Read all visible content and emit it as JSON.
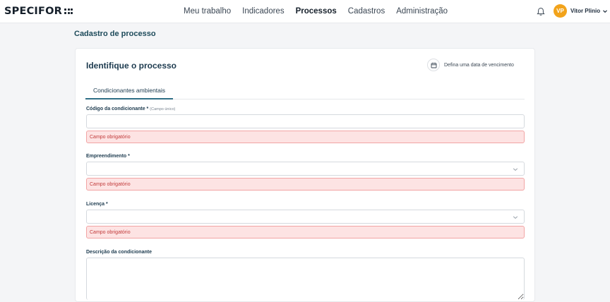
{
  "app": {
    "logo_text": "SPECIFOR"
  },
  "nav": {
    "items": [
      {
        "label": "Meu trabalho"
      },
      {
        "label": "Indicadores"
      },
      {
        "label": "Processos",
        "active": true
      },
      {
        "label": "Cadastros"
      },
      {
        "label": "Administração"
      }
    ]
  },
  "user": {
    "initials": "VP",
    "name": "Vitor Plinio",
    "avatar_color": "#f2a31b"
  },
  "icons": {
    "bell": "bell-icon",
    "user_menu": "chevron-down-icon",
    "calendar": "calendar-icon",
    "select": "chevron-down-icon"
  },
  "page": {
    "title": "Cadastro de processo"
  },
  "card": {
    "title": "Identifique o processo",
    "due_date_label": "Defina uma data de vencimento",
    "tab": "Condicionantes ambientais"
  },
  "form": {
    "codigo": {
      "label": "Código da condicionante *",
      "hint": "(Campo único)",
      "value": "",
      "error": "Campo obrigatório"
    },
    "empreendimento": {
      "label": "Empreendimento *",
      "value": "",
      "error": "Campo obrigatório"
    },
    "licenca": {
      "label": "Licença *",
      "value": "",
      "error": "Campo obrigatório"
    },
    "descricao": {
      "label": "Descrição da condicionante",
      "value": ""
    }
  },
  "colors": {
    "accent": "#2f6f86",
    "title": "#1d4a5a",
    "error_bg": "#fde3e3",
    "error_border": "#f2a4a4",
    "error_text": "#c23b3b"
  }
}
